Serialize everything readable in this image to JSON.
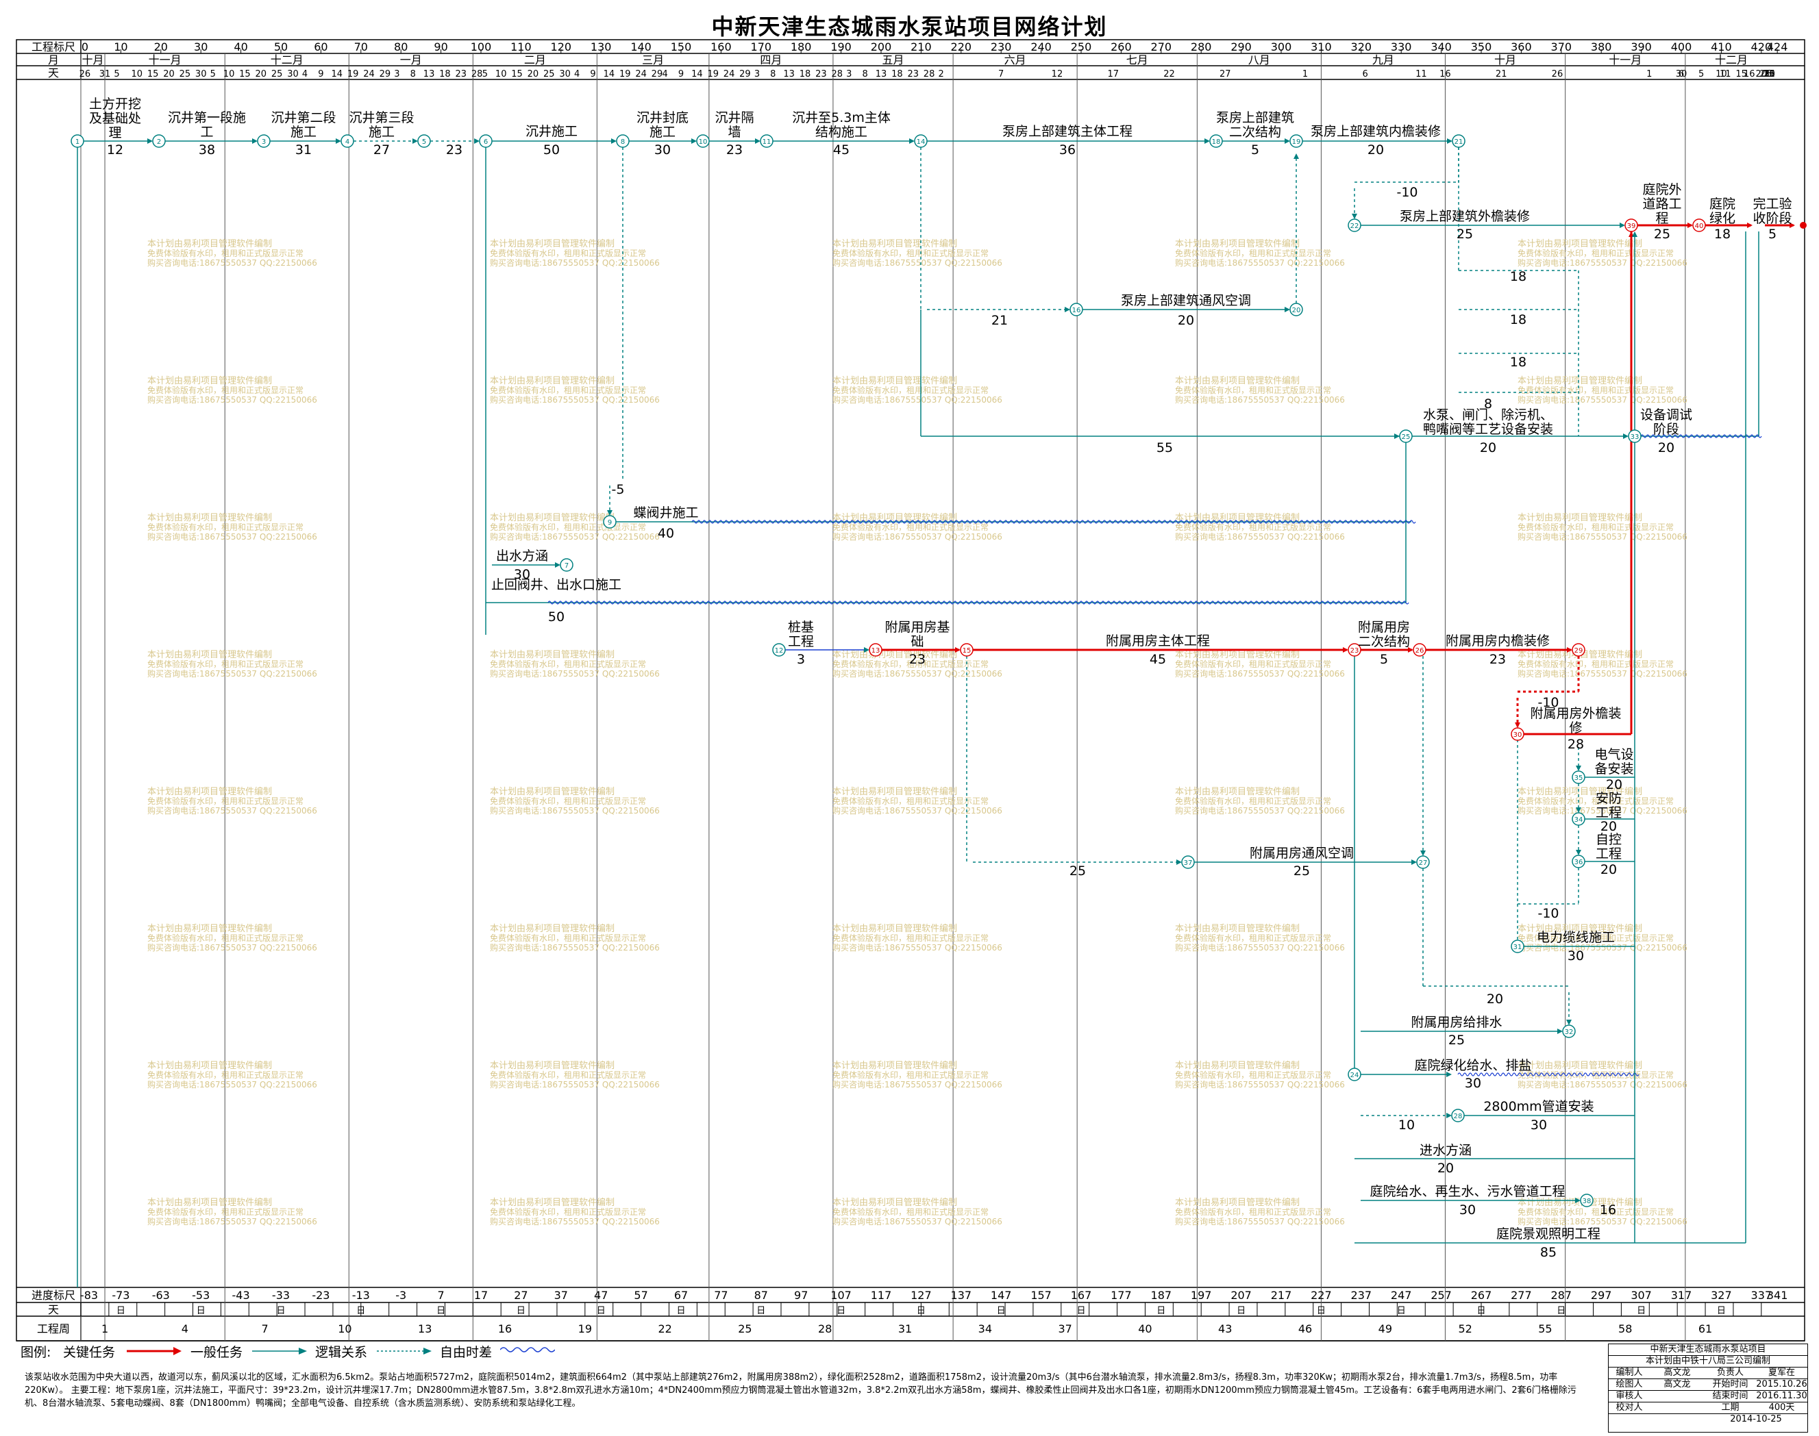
{
  "title": "中新天津生态城雨水泵站项目网络计划",
  "scale_top": {
    "row1_label": "工程标尺",
    "ticks": [
      "0",
      "10",
      "20",
      "30",
      "40",
      "50",
      "60",
      "70",
      "80",
      "90",
      "100",
      "110",
      "120",
      "130",
      "140",
      "150",
      "160",
      "170",
      "180",
      "190",
      "200",
      "210",
      "220",
      "230",
      "240",
      "250",
      "260",
      "270",
      "280",
      "290",
      "300",
      "310",
      "320",
      "330",
      "340",
      "350",
      "360",
      "370",
      "380",
      "390",
      "400",
      "410",
      "420",
      "424"
    ],
    "row2_label": "月",
    "months": [
      "十月",
      "十一月",
      "十二月",
      "一月",
      "二月",
      "三月",
      "四月",
      "五月",
      "六月",
      "七月",
      "八月",
      "九月",
      "十月",
      "十一月",
      "十二月"
    ],
    "row3_label": "天",
    "days": [
      "26",
      "31",
      "5",
      "10",
      "15",
      "20",
      "25",
      "30",
      "5",
      "10",
      "15",
      "20",
      "25",
      "30",
      "4",
      "9",
      "14",
      "19",
      "24",
      "29",
      "3",
      "8",
      "13",
      "18",
      "23",
      "28",
      "5",
      "10",
      "15",
      "20",
      "25",
      "30",
      "4",
      "9",
      "14",
      "19",
      "24",
      "29",
      "4",
      "9",
      "14",
      "19",
      "24",
      "29",
      "3",
      "8",
      "13",
      "18",
      "23",
      "28",
      "3",
      "8",
      "13",
      "18",
      "23",
      "28",
      "2",
      "7",
      "12",
      "17",
      "22",
      "27",
      "1",
      "6",
      "11",
      "16",
      "21",
      "26",
      "1",
      "6",
      "11",
      "16",
      "21",
      "26",
      "31",
      "5",
      "10",
      "15",
      "20",
      "25",
      "30",
      "5",
      "10",
      "15",
      "20"
    ]
  },
  "scale_bottom": {
    "row1_label": "进度标尺",
    "ticks": [
      "-83",
      "-73",
      "-63",
      "-53",
      "-43",
      "-33",
      "-23",
      "-13",
      "-3",
      "7",
      "17",
      "27",
      "37",
      "47",
      "57",
      "67",
      "77",
      "87",
      "97",
      "107",
      "117",
      "127",
      "137",
      "147",
      "157",
      "167",
      "177",
      "187",
      "197",
      "207",
      "217",
      "227",
      "237",
      "247",
      "257",
      "267",
      "277",
      "287",
      "297",
      "307",
      "317",
      "327",
      "337",
      "341"
    ],
    "row2_label": "天",
    "day_cell": "日",
    "row3_label": "工程周",
    "weeks": [
      "1",
      "4",
      "7",
      "10",
      "13",
      "16",
      "19",
      "22",
      "25",
      "28",
      "31",
      "34",
      "37",
      "40",
      "43",
      "46",
      "49",
      "52",
      "55",
      "58",
      "61"
    ]
  },
  "tasks": {
    "t1": {
      "name": "土方开挖及基础处理",
      "dur": "12"
    },
    "t2": {
      "name": "沉井第一段施工",
      "dur": "38"
    },
    "t3": {
      "name": "沉井第二段施工",
      "dur": "31"
    },
    "t4": {
      "name": "沉井第三段施工",
      "dur": "27"
    },
    "t5": {
      "dur": "23"
    },
    "t6": {
      "name": "沉井施工",
      "dur": "50"
    },
    "t7": {
      "name": "沉井封底施工",
      "dur": "30"
    },
    "t8": {
      "name": "沉井隔墙",
      "dur": "23"
    },
    "t9": {
      "name": "沉井至5.3m主体结构施工",
      "dur": "45"
    },
    "t10": {
      "name": "泵房上部建筑主体工程",
      "dur": "36"
    },
    "t11": {
      "name": "泵房上部建筑二次结构",
      "dur": "5"
    },
    "t12": {
      "name": "泵房上部建筑内檐装修",
      "dur": "20"
    },
    "t13": {
      "name": "泵房上部建筑外檐装修",
      "dur": "25"
    },
    "t14": {
      "name": "庭院外道路工程",
      "dur": "25"
    },
    "t15": {
      "name": "庭院绿化",
      "dur": "18"
    },
    "t16": {
      "name": "完工验收阶段",
      "dur": "5"
    },
    "t17": {
      "name": "泵房上部建筑通风空调",
      "dur": "20",
      "lag": "21"
    },
    "t18": {
      "name": "水泵、闸门、除污机、鸭嘴阀等工艺设备安装",
      "dur": "20",
      "lag": "55"
    },
    "t19": {
      "name": "设备调试阶段",
      "dur": "20"
    },
    "t20": {
      "name": "蝶阀井施工",
      "dur": "40"
    },
    "t21": {
      "name": "出水方涵",
      "dur": "30"
    },
    "t22": {
      "name": "止回阀井、出水口施工",
      "dur": "50"
    },
    "t23": {
      "name": "桩基工程",
      "dur": "3"
    },
    "t24": {
      "name": "附属用房基础",
      "dur": "23"
    },
    "t25": {
      "name": "附属用房主体工程",
      "dur": "45"
    },
    "t26": {
      "name": "附属用房二次结构",
      "dur": "5"
    },
    "t27": {
      "name": "附属用房内檐装修",
      "dur": "23"
    },
    "t28": {
      "name": "附属用房外檐装修",
      "dur": "28"
    },
    "t29": {
      "name": "电气设备安装",
      "dur": "20"
    },
    "t30": {
      "name": "安防工程",
      "dur": "20"
    },
    "t31": {
      "name": "自控工程",
      "dur": "20"
    },
    "t32": {
      "name": "附属用房通风空调",
      "dur": "25",
      "lag": "25"
    },
    "t33": {
      "name": "电力缆线施工",
      "dur": "30"
    },
    "t34": {
      "name": "附属用房给排水",
      "dur": "25",
      "lag": "20"
    },
    "t35": {
      "name": "庭院绿化给水、排盐",
      "dur": "30"
    },
    "t36": {
      "name": "2800mm管道安装",
      "dur": "30",
      "lag": "10"
    },
    "t37": {
      "name": "进水方涵",
      "dur": "20"
    },
    "t38": {
      "name": "庭院给水、再生水、污水管道工程",
      "dur": "30",
      "lag": "16"
    },
    "t39": {
      "name": "庭院景观照明工程",
      "dur": "85"
    }
  },
  "float_labels": {
    "f1": "-10",
    "f2": "18",
    "f3": "18",
    "f4": "18",
    "f5": "8",
    "f6": "-5",
    "f7": "-10",
    "f8": "-10"
  },
  "nodes": [
    "1",
    "2",
    "3",
    "4",
    "5",
    "6",
    "7",
    "8",
    "9",
    "10",
    "11",
    "12",
    "13",
    "14",
    "15",
    "16",
    "18",
    "19",
    "20",
    "21",
    "22",
    "23",
    "24",
    "25",
    "26",
    "27",
    "28",
    "29",
    "30",
    "31",
    "32",
    "33",
    "34",
    "35",
    "36",
    "37",
    "38",
    "39",
    "40"
  ],
  "watermark": {
    "line1": "本计划由易利项目管理软件编制",
    "line2": "免费体验版有水印，租用和正式版显示正常",
    "line3": "购买咨询电话:18675550537 QQ:22150066"
  },
  "legend": {
    "label": "图例:",
    "key_task": "关键任务",
    "normal_task": "一般任务",
    "logic": "逻辑关系",
    "free_float": "自由时差",
    "colors": {
      "key": "#e00000",
      "normal": "#008080",
      "float": "#1a3fd1"
    }
  },
  "notes": "该泵站收水范围为中央大道以西，故道河以东，蓟风溪以北的区域，汇水面积为6.5km2。泵站占地面积5727m2，庭院面积5014m2，建筑面积664m2（其中泵站上部建筑276m2，附属用房388m2），绿化面积2528m2，道路面积1758m2，设计流量20m3/s（其中6台潜水轴流泵，排水流量2.8m3/s，扬程8.3m，功率320Kw；初期雨水泵2台，排水流量1.7m3/s，扬程8.5m，功率220Kw）。 主要工程：地下泵房1座，沉井法施工，平面尺寸：39*23.2m，设计沉井埋深17.7m；DN2800mm进水管87.5m，3.8*2.8m双孔进水方涵10m；4*DN2400mm预应力钢筒混凝土管出水管道32m，3.8*2.2m双孔出水方涵58m，蝶阀井、橡胶柔性止回阀井及出水口各1座，初期雨水DN1200mm预应力钢筒混凝土管45m。工艺设备有：6套手电两用进水闸门、2套6门格栅除污机、8台潜水轴流泵、5套电动蝶阀、8套（DN1800mm）鸭嘴阀；全部电气设备、自控系统（含水质监测系统）、安防系统和泵站绿化工程。",
  "titleblock": {
    "project": "中新天津生态城雨水泵站项目",
    "author_line": "本计划由中铁十八局三公司编制",
    "r_editor": "编制人",
    "editor": "高文龙",
    "r_lead": "负责人",
    "lead": "夏军在",
    "r_drawer": "绘图人",
    "drawer": "高文龙",
    "r_start": "开始时间",
    "start": "2015.10.26",
    "r_reviewer": "审核人",
    "r_end": "结束时间",
    "end": "2016.11.30",
    "r_checker": "校对人",
    "r_period": "工期",
    "period": "400天",
    "date": "2014-10-25"
  }
}
